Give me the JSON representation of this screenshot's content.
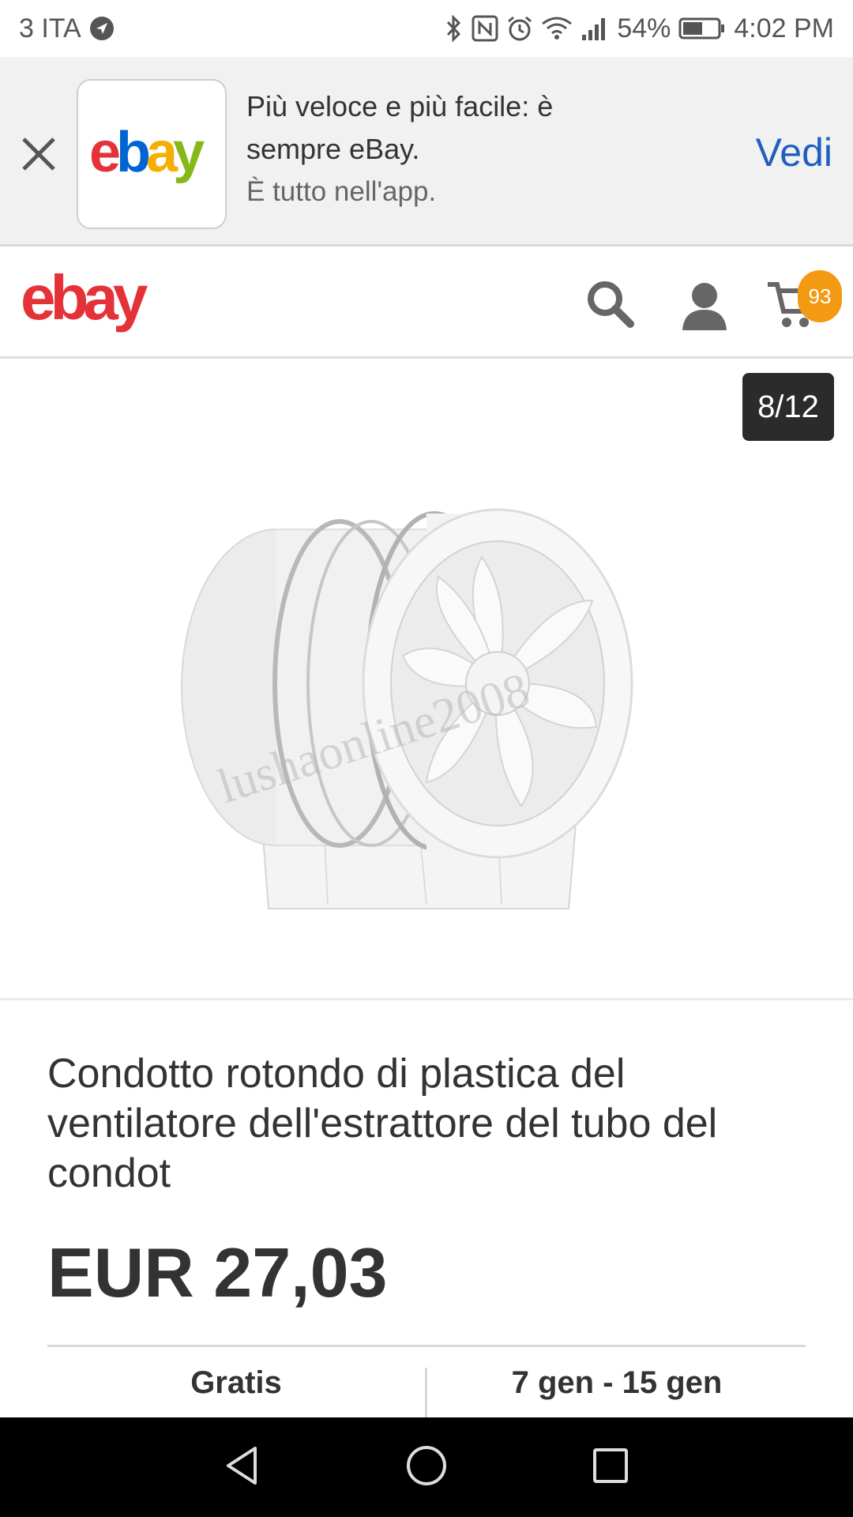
{
  "status_bar": {
    "carrier": "3 ITA",
    "battery": "54%",
    "time": "4:02 PM"
  },
  "app_banner": {
    "line1": "Più veloce e più facile: è",
    "line2": "sempre eBay.",
    "subtitle": "È tutto nell'app.",
    "action": "Vedi",
    "logo_text": "ebay"
  },
  "header": {
    "logo_text": "ebay",
    "cart_count": "93"
  },
  "gallery": {
    "counter": "8/12",
    "watermark": "lushaonline2008"
  },
  "product": {
    "title": "Condotto rotondo di plastica del ventilatore dell'estrattore del tubo del condot",
    "price": "EUR 27,03"
  },
  "shipping": {
    "cost": "Gratis",
    "delivery": "7 gen - 15 gen"
  },
  "colors": {
    "ebay_red": "#e53238",
    "ebay_blue": "#0064d2",
    "ebay_yellow": "#f5af02",
    "ebay_green": "#86b817",
    "link_blue": "#1f5fbf",
    "badge_orange": "#f39a12"
  },
  "icons": [
    "location-arrow-icon",
    "bluetooth-icon",
    "nfc-icon",
    "alarm-icon",
    "wifi-icon",
    "signal-icon",
    "battery-icon",
    "close-icon",
    "search-icon",
    "user-icon",
    "cart-icon",
    "back-nav-icon",
    "home-nav-icon",
    "recents-nav-icon"
  ]
}
